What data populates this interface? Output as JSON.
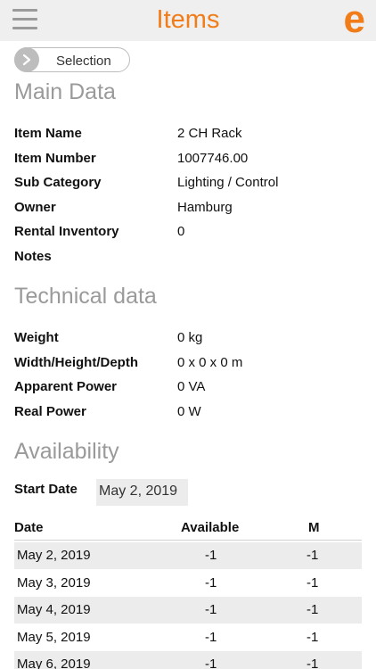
{
  "header": {
    "title": "Items",
    "logo_letter": "e",
    "menu_icon": "hamburger-icon",
    "accent_color": "#f07d1a"
  },
  "selection": {
    "label": "Selection",
    "icon": "chevron-right-icon"
  },
  "main_data": {
    "title": "Main Data",
    "rows": [
      {
        "label": "Item Name",
        "value": "2 CH Rack"
      },
      {
        "label": "Item Number",
        "value": "1007746.00"
      },
      {
        "label": "Sub Category",
        "value": "Lighting / Control"
      },
      {
        "label": "Owner",
        "value": "Hamburg"
      },
      {
        "label": "Rental Inventory",
        "value": "0"
      },
      {
        "label": "Notes",
        "value": ""
      }
    ]
  },
  "technical_data": {
    "title": "Technical data",
    "rows": [
      {
        "label": "Weight",
        "value": "0 kg"
      },
      {
        "label": "Width/Height/Depth",
        "value": "0 x 0 x 0 m"
      },
      {
        "label": "Apparent Power",
        "value": "0 VA"
      },
      {
        "label": "Real Power",
        "value": "0 W"
      }
    ]
  },
  "availability": {
    "title": "Availability",
    "start_date_label": "Start Date",
    "start_date_value": "May 2, 2019",
    "columns": [
      "Date",
      "Available",
      "M"
    ],
    "rows": [
      {
        "date": "May 2, 2019",
        "available": "-1",
        "m": "-1"
      },
      {
        "date": "May 3, 2019",
        "available": "-1",
        "m": "-1"
      },
      {
        "date": "May 4, 2019",
        "available": "-1",
        "m": "-1"
      },
      {
        "date": "May 5, 2019",
        "available": "-1",
        "m": "-1"
      },
      {
        "date": "May 6, 2019",
        "available": "-1",
        "m": "-1"
      }
    ]
  }
}
